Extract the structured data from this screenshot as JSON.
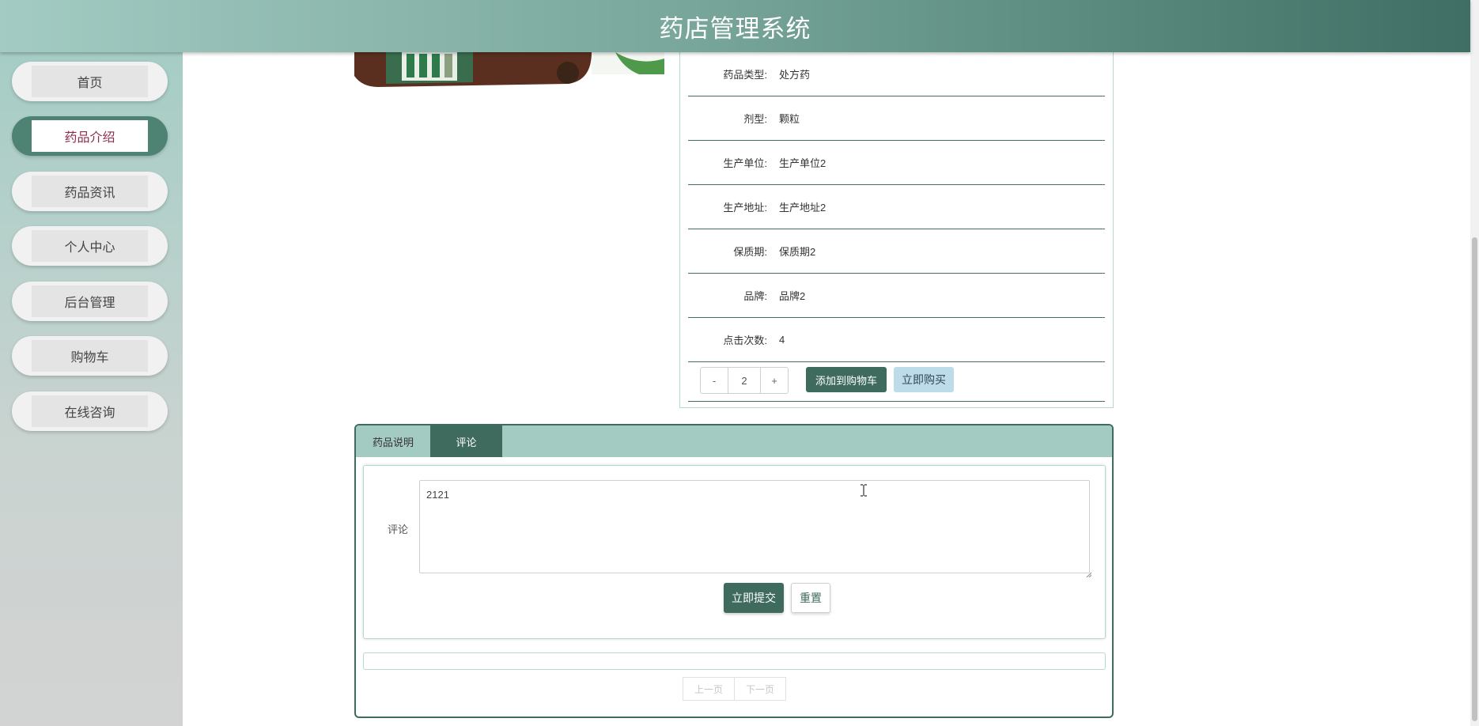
{
  "header": {
    "title": "药店管理系统"
  },
  "sidebar": {
    "items": [
      {
        "label": "首页",
        "active": false
      },
      {
        "label": "药品介绍",
        "active": true
      },
      {
        "label": "药品资讯",
        "active": false
      },
      {
        "label": "个人中心",
        "active": false
      },
      {
        "label": "后台管理",
        "active": false
      },
      {
        "label": "购物车",
        "active": false
      },
      {
        "label": "在线咨询",
        "active": false
      }
    ]
  },
  "details": {
    "rows": [
      {
        "label": "药品类型:",
        "value": "处方药"
      },
      {
        "label": "剂型:",
        "value": "颗粒"
      },
      {
        "label": "生产单位:",
        "value": "生产单位2"
      },
      {
        "label": "生产地址:",
        "value": "生产地址2"
      },
      {
        "label": "保质期:",
        "value": "保质期2"
      },
      {
        "label": "品牌:",
        "value": "品牌2"
      },
      {
        "label": "点击次数:",
        "value": "4"
      }
    ],
    "quantity": {
      "minus": "-",
      "value": "2",
      "plus": "+"
    },
    "add_to_cart": "添加到购物车",
    "buy_now": "立即购买"
  },
  "tabs": {
    "items": [
      {
        "label": "药品说明",
        "active": false
      },
      {
        "label": "评论",
        "active": true
      }
    ]
  },
  "comment_form": {
    "label": "评论",
    "value": "2121",
    "submit": "立即提交",
    "reset": "重置"
  },
  "pager": {
    "prev": "上一页",
    "next": "下一页"
  },
  "colors": {
    "accent": "#3f6b5e",
    "header_start": "#a3cbc3",
    "header_end": "#3f6f64",
    "active_text": "#8b2d4f",
    "buy_button": "#bddcea"
  }
}
